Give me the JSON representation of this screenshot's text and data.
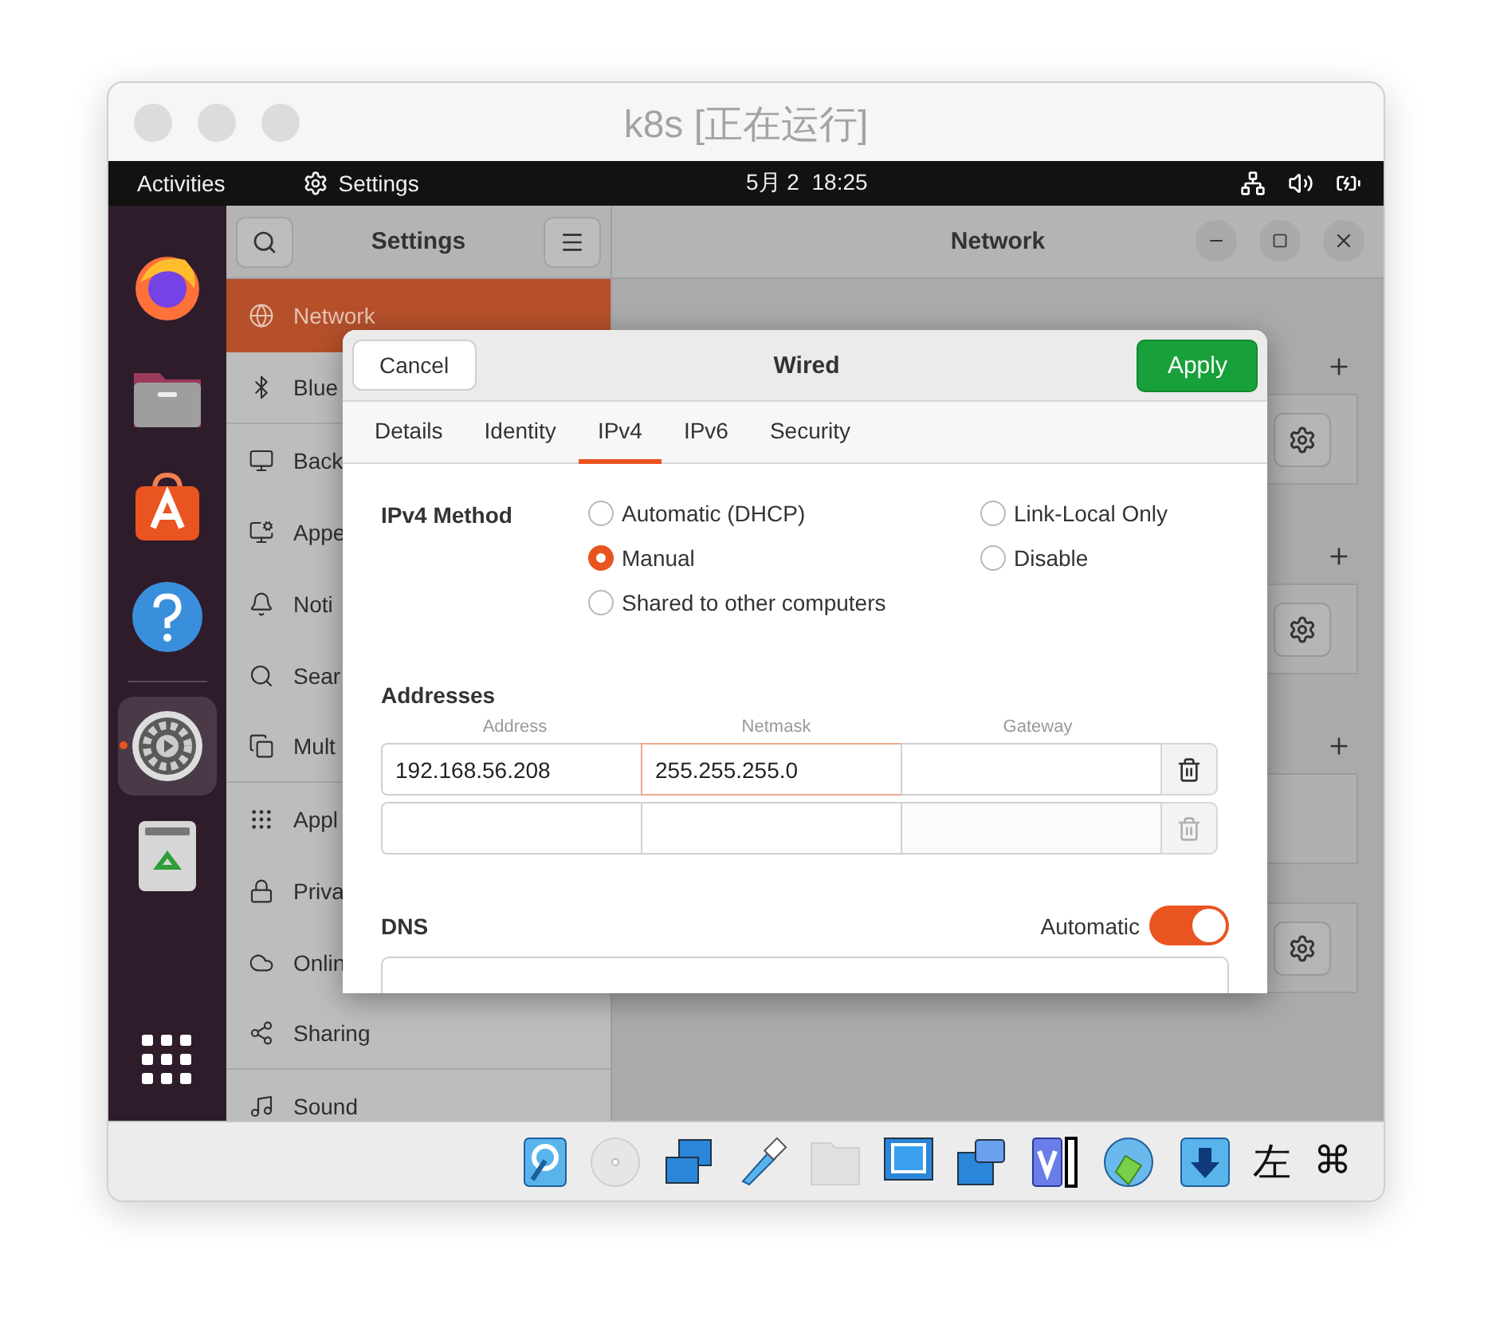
{
  "vm_window": {
    "title": "k8s [正在运行]"
  },
  "top_bar": {
    "activities": "Activities",
    "app": "Settings",
    "clock": "5月 2  18:25"
  },
  "dock": [
    {
      "kind": "firefox",
      "active": false
    },
    {
      "kind": "files",
      "active": false
    },
    {
      "kind": "store",
      "active": false
    },
    {
      "kind": "help",
      "active": false
    },
    {
      "kind": "settings",
      "active": true
    },
    {
      "kind": "trash",
      "active": false
    }
  ],
  "settings": {
    "sidebar_title": "Settings",
    "panel_title": "Network",
    "sidebar_items": [
      {
        "kind": "network",
        "label": "Network",
        "selected": true
      },
      {
        "kind": "bluetooth",
        "label": "Blue",
        "selected": false
      },
      {
        "kind": "background",
        "label": "Back",
        "selected": false
      },
      {
        "kind": "appearance",
        "label": "Appe",
        "selected": false
      },
      {
        "kind": "notifications",
        "label": "Noti",
        "selected": false
      },
      {
        "kind": "search",
        "label": "Sear",
        "selected": false
      },
      {
        "kind": "multitasking",
        "label": "Mult",
        "selected": false
      },
      {
        "kind": "apps",
        "label": "Appl",
        "selected": false
      },
      {
        "kind": "privacy",
        "label": "Priva",
        "selected": false
      },
      {
        "kind": "online",
        "label": "Onlin",
        "selected": false
      },
      {
        "kind": "sharing",
        "label": "Sharing",
        "selected": false
      },
      {
        "kind": "sound",
        "label": "Sound",
        "selected": false
      }
    ]
  },
  "dialog": {
    "cancel": "Cancel",
    "title": "Wired",
    "apply": "Apply",
    "tabs": [
      {
        "label": "Details",
        "selected": false
      },
      {
        "label": "Identity",
        "selected": false
      },
      {
        "label": "IPv4",
        "selected": true
      },
      {
        "label": "IPv6",
        "selected": false
      },
      {
        "label": "Security",
        "selected": false
      }
    ],
    "method_label": "IPv4 Method",
    "methods": [
      {
        "label": "Automatic (DHCP)",
        "selected": false
      },
      {
        "label": "Manual",
        "selected": true
      },
      {
        "label": "Shared to other computers",
        "selected": false
      },
      {
        "label": "Link-Local Only",
        "selected": false
      },
      {
        "label": "Disable",
        "selected": false
      }
    ],
    "addresses_label": "Addresses",
    "columns": [
      "Address",
      "Netmask",
      "Gateway"
    ],
    "address_rows": [
      {
        "disabled": false,
        "cells": [
          {
            "value": "192.168.56.208",
            "focused": false
          },
          {
            "value": "255.255.255.0",
            "focused": true
          },
          {
            "focused": false
          }
        ]
      },
      {
        "disabled": true,
        "cells": [
          {
            "focused": false
          },
          {
            "focused": false
          },
          {
            "focused": false
          }
        ]
      }
    ],
    "dns_label": "DNS",
    "dns_automatic_label": "Automatic",
    "dns_automatic_on": true
  },
  "status_bar": {
    "icons": [
      {
        "kind": "hdd"
      },
      {
        "kind": "optical"
      },
      {
        "kind": "network"
      },
      {
        "kind": "usb"
      },
      {
        "kind": "folder"
      },
      {
        "kind": "display"
      },
      {
        "kind": "capture"
      },
      {
        "kind": "recording"
      },
      {
        "kind": "mouse"
      },
      {
        "kind": "arrow"
      }
    ],
    "host_key": [
      "左",
      "⌘"
    ]
  }
}
